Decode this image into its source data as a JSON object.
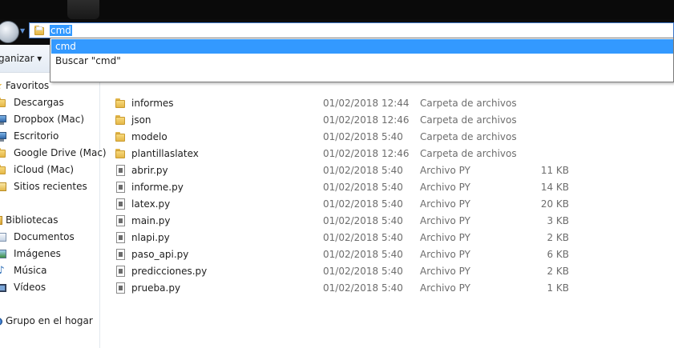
{
  "address_bar": {
    "value": "cmd"
  },
  "autocomplete": {
    "items": [
      {
        "label": "cmd"
      },
      {
        "label": "Buscar \"cmd\""
      }
    ]
  },
  "toolbar": {
    "organize_label": "ganizar ▾"
  },
  "nav_pane": {
    "favorites_header": "Favoritos",
    "favorites": [
      {
        "label": "Descargas",
        "icon": "folder-icon"
      },
      {
        "label": "Dropbox (Mac)",
        "icon": "folder-icon"
      },
      {
        "label": "Escritorio",
        "icon": "desktop-icon"
      },
      {
        "label": "Google Drive (Mac)",
        "icon": "folder-icon"
      },
      {
        "label": "iCloud (Mac)",
        "icon": "folder-icon"
      },
      {
        "label": "Sitios recientes",
        "icon": "recent-places-icon"
      }
    ],
    "libraries_header": "Bibliotecas",
    "libraries": [
      {
        "label": "Documentos",
        "icon": "documents-icon"
      },
      {
        "label": "Imágenes",
        "icon": "pictures-icon"
      },
      {
        "label": "Música",
        "icon": "music-icon"
      },
      {
        "label": "Vídeos",
        "icon": "videos-icon"
      }
    ],
    "homegroup_label": "Grupo en el hogar"
  },
  "files": [
    {
      "name": "informes",
      "date": "01/02/2018 12:44",
      "type": "Carpeta de archivos",
      "size": "",
      "icon": "folder-icon"
    },
    {
      "name": "json",
      "date": "01/02/2018 12:46",
      "type": "Carpeta de archivos",
      "size": "",
      "icon": "folder-icon"
    },
    {
      "name": "modelo",
      "date": "01/02/2018 5:40",
      "type": "Carpeta de archivos",
      "size": "",
      "icon": "folder-icon"
    },
    {
      "name": "plantillaslatex",
      "date": "01/02/2018 12:46",
      "type": "Carpeta de archivos",
      "size": "",
      "icon": "folder-icon"
    },
    {
      "name": "abrir.py",
      "date": "01/02/2018 5:40",
      "type": "Archivo PY",
      "size": "11 KB",
      "icon": "python-file-icon"
    },
    {
      "name": "informe.py",
      "date": "01/02/2018 5:40",
      "type": "Archivo PY",
      "size": "14 KB",
      "icon": "python-file-icon"
    },
    {
      "name": "latex.py",
      "date": "01/02/2018 5:40",
      "type": "Archivo PY",
      "size": "20 KB",
      "icon": "python-file-icon"
    },
    {
      "name": "main.py",
      "date": "01/02/2018 5:40",
      "type": "Archivo PY",
      "size": "3 KB",
      "icon": "python-file-icon"
    },
    {
      "name": "nlapi.py",
      "date": "01/02/2018 5:40",
      "type": "Archivo PY",
      "size": "2 KB",
      "icon": "python-file-icon"
    },
    {
      "name": "paso_api.py",
      "date": "01/02/2018 5:40",
      "type": "Archivo PY",
      "size": "6 KB",
      "icon": "python-file-icon"
    },
    {
      "name": "predicciones.py",
      "date": "01/02/2018 5:40",
      "type": "Archivo PY",
      "size": "2 KB",
      "icon": "python-file-icon"
    },
    {
      "name": "prueba.py",
      "date": "01/02/2018 5:40",
      "type": "Archivo PY",
      "size": "1 KB",
      "icon": "python-file-icon"
    }
  ],
  "colors": {
    "selection": "#3399ff",
    "address_border": "#3b74c7",
    "secondary_text": "#6d6d6d",
    "folder_yellow": "#e5b848"
  }
}
